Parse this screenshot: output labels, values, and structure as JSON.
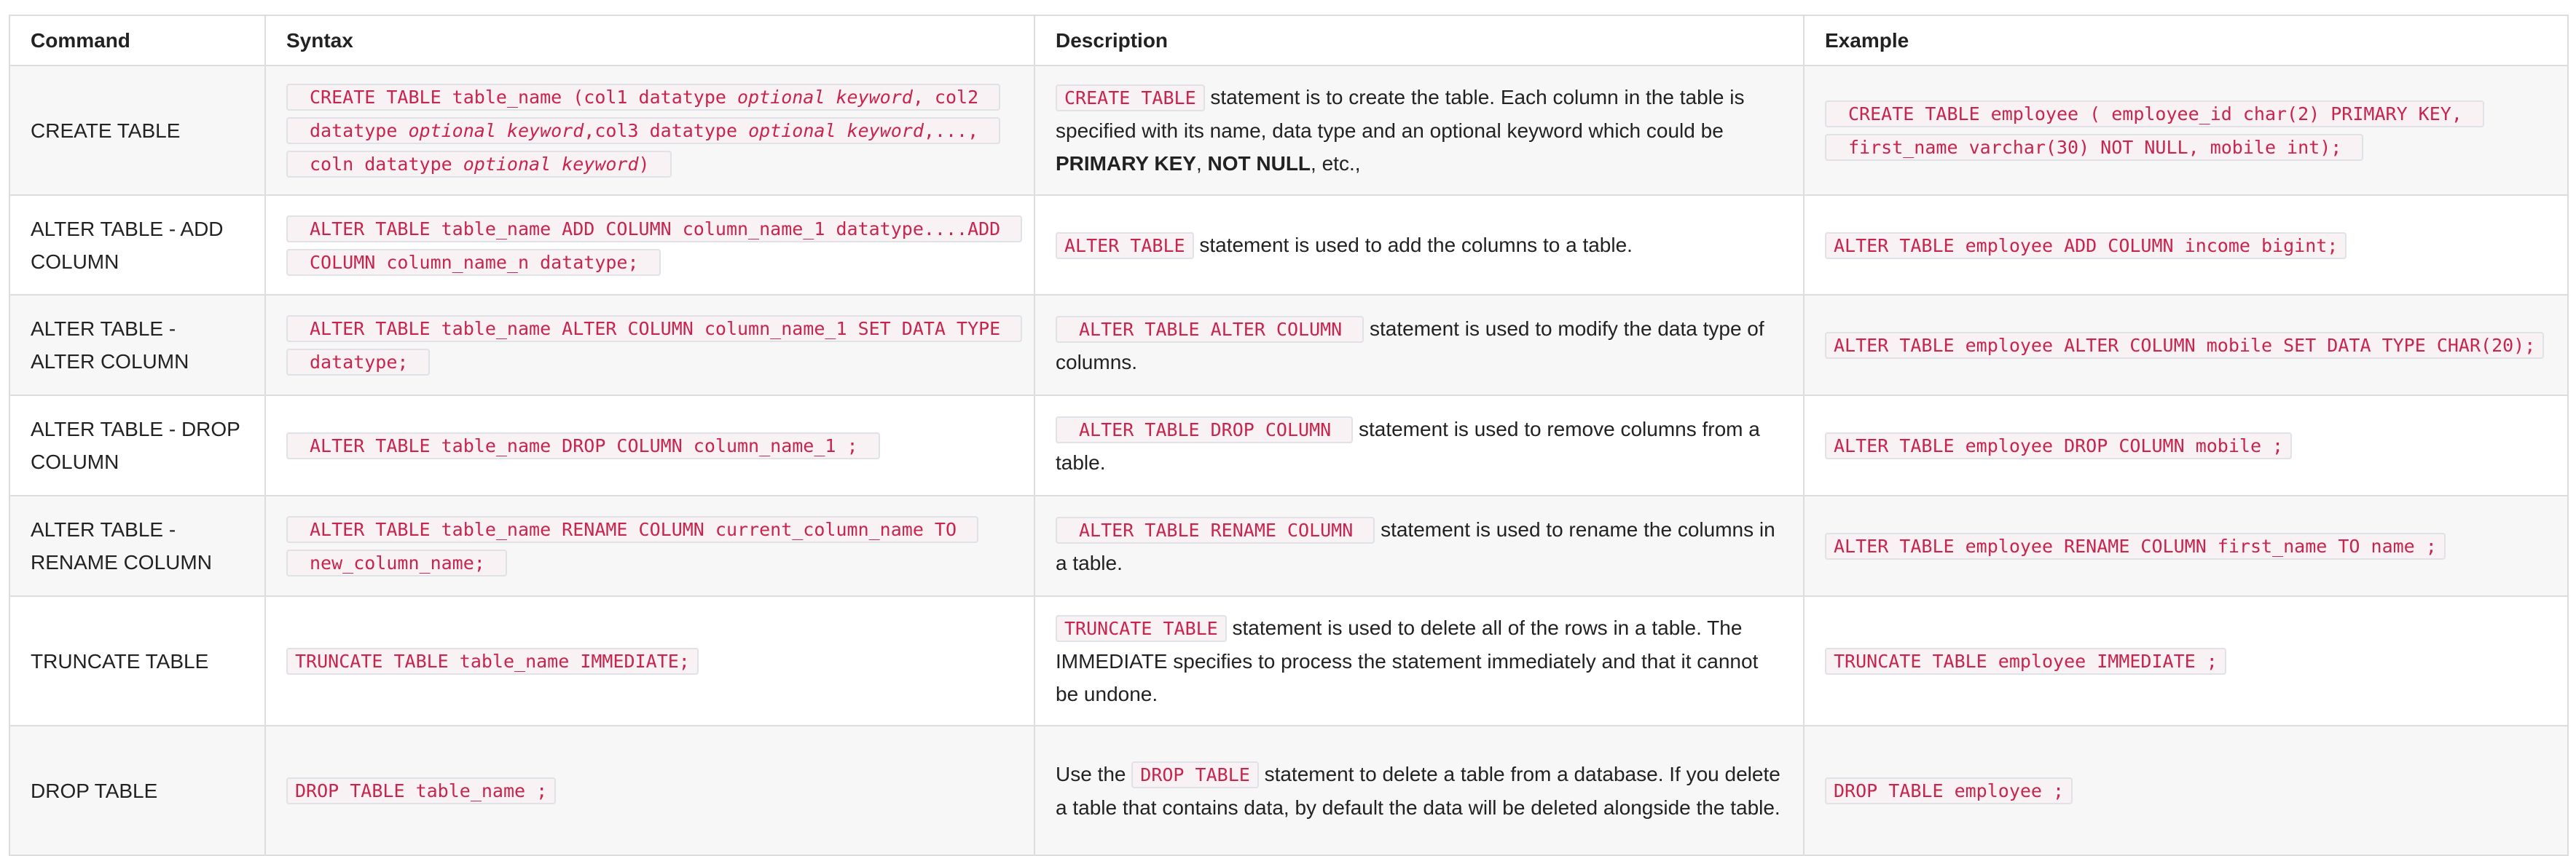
{
  "headers": [
    "Command",
    "Syntax",
    "Description",
    "Example"
  ],
  "rows": [
    {
      "command": "CREATE TABLE",
      "syntax": [
        "CREATE TABLE table_name (col1 datatype ",
        "optional keyword",
        ", col2 datatype ",
        "optional keyword",
        ",col3 datatype ",
        "optional keyword",
        ",...,",
        "coln datatype ",
        "optional keyword",
        ")"
      ],
      "desc_code": "CREATE TABLE",
      "desc_text": " statement is to create the table. Each column in the table is specified with its name, data type and an optional keyword which could be ",
      "desc_bold_1": "PRIMARY KEY",
      "desc_sep": ", ",
      "desc_bold_2": "NOT NULL",
      "desc_end": ", etc.,",
      "example": "CREATE TABLE employee ( employee_id char(2) PRIMARY KEY, first_name varchar(30) NOT NULL, mobile int);"
    },
    {
      "command": "ALTER TABLE - ADD COLUMN",
      "syntax": "ALTER TABLE table_name ADD COLUMN column_name_1 datatype....ADD COLUMN column_name_n datatype;",
      "desc_code": "ALTER TABLE",
      "desc_text": " statement is used to add the columns to a table.",
      "example": "ALTER TABLE employee ADD COLUMN income bigint;"
    },
    {
      "command": "ALTER TABLE - ALTER COLUMN",
      "syntax": "ALTER TABLE table_name ALTER COLUMN column_name_1 SET DATA TYPE datatype;",
      "desc_code": "ALTER TABLE ALTER COLUMN",
      "desc_text": " statement is used to modify the data type of columns.",
      "example": "ALTER TABLE employee ALTER COLUMN mobile SET DATA TYPE CHAR(20);"
    },
    {
      "command": "ALTER TABLE - DROP COLUMN",
      "syntax": "ALTER TABLE table_name DROP COLUMN column_name_1 ;",
      "desc_code": "ALTER TABLE DROP COLUMN",
      "desc_text": " statement is used to remove columns from a table.",
      "example": "ALTER TABLE employee DROP COLUMN mobile ;"
    },
    {
      "command": "ALTER TABLE - RENAME COLUMN",
      "syntax": "ALTER TABLE table_name RENAME COLUMN current_column_name TO new_column_name;",
      "desc_code": "ALTER TABLE RENAME COLUMN",
      "desc_text": " statement is used to rename the columns in a table.",
      "example": "ALTER TABLE employee RENAME COLUMN first_name TO name ;"
    },
    {
      "command": "TRUNCATE TABLE",
      "syntax": "TRUNCATE TABLE table_name IMMEDIATE;",
      "desc_code": "TRUNCATE TABLE",
      "desc_text": " statement is used to delete all of the rows in a table. The IMMEDIATE specifies to process the statement immediately and that it cannot be undone.",
      "example": "TRUNCATE TABLE employee IMMEDIATE ;"
    },
    {
      "command": "DROP TABLE",
      "syntax": "DROP TABLE table_name ;",
      "desc_pre": "Use the ",
      "desc_code": "DROP TABLE",
      "desc_text": " statement to delete a table from a database. If you delete a table that contains data, by default the data will be deleted alongside the table.",
      "example": "DROP TABLE employee ;"
    }
  ]
}
